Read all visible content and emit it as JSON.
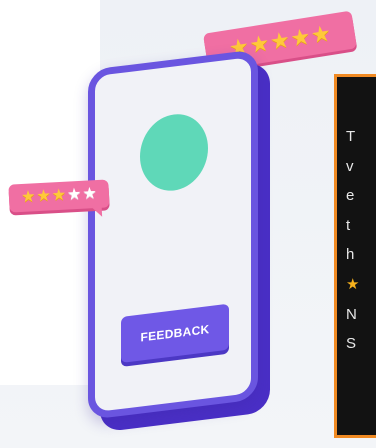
{
  "phone": {
    "button_label": "FEEDBACK"
  },
  "ratings": {
    "top": {
      "stars_filled": 5,
      "stars_total": 5
    },
    "left": {
      "stars_filled": 3,
      "stars_total": 5
    }
  },
  "tooltip": {
    "lines": [
      "T",
      "v",
      "e",
      "t",
      "h",
      "★",
      "N",
      "S"
    ]
  },
  "colors": {
    "phone_frame": "#6a55e0",
    "screen_circle": "#5fd8b8",
    "bubble": "#f06fa3",
    "star_filled": "#ffc93a",
    "tooltip_border": "#f08a23"
  },
  "icons": {
    "star_filled": "star-icon",
    "star_empty": "star-outline-icon"
  }
}
